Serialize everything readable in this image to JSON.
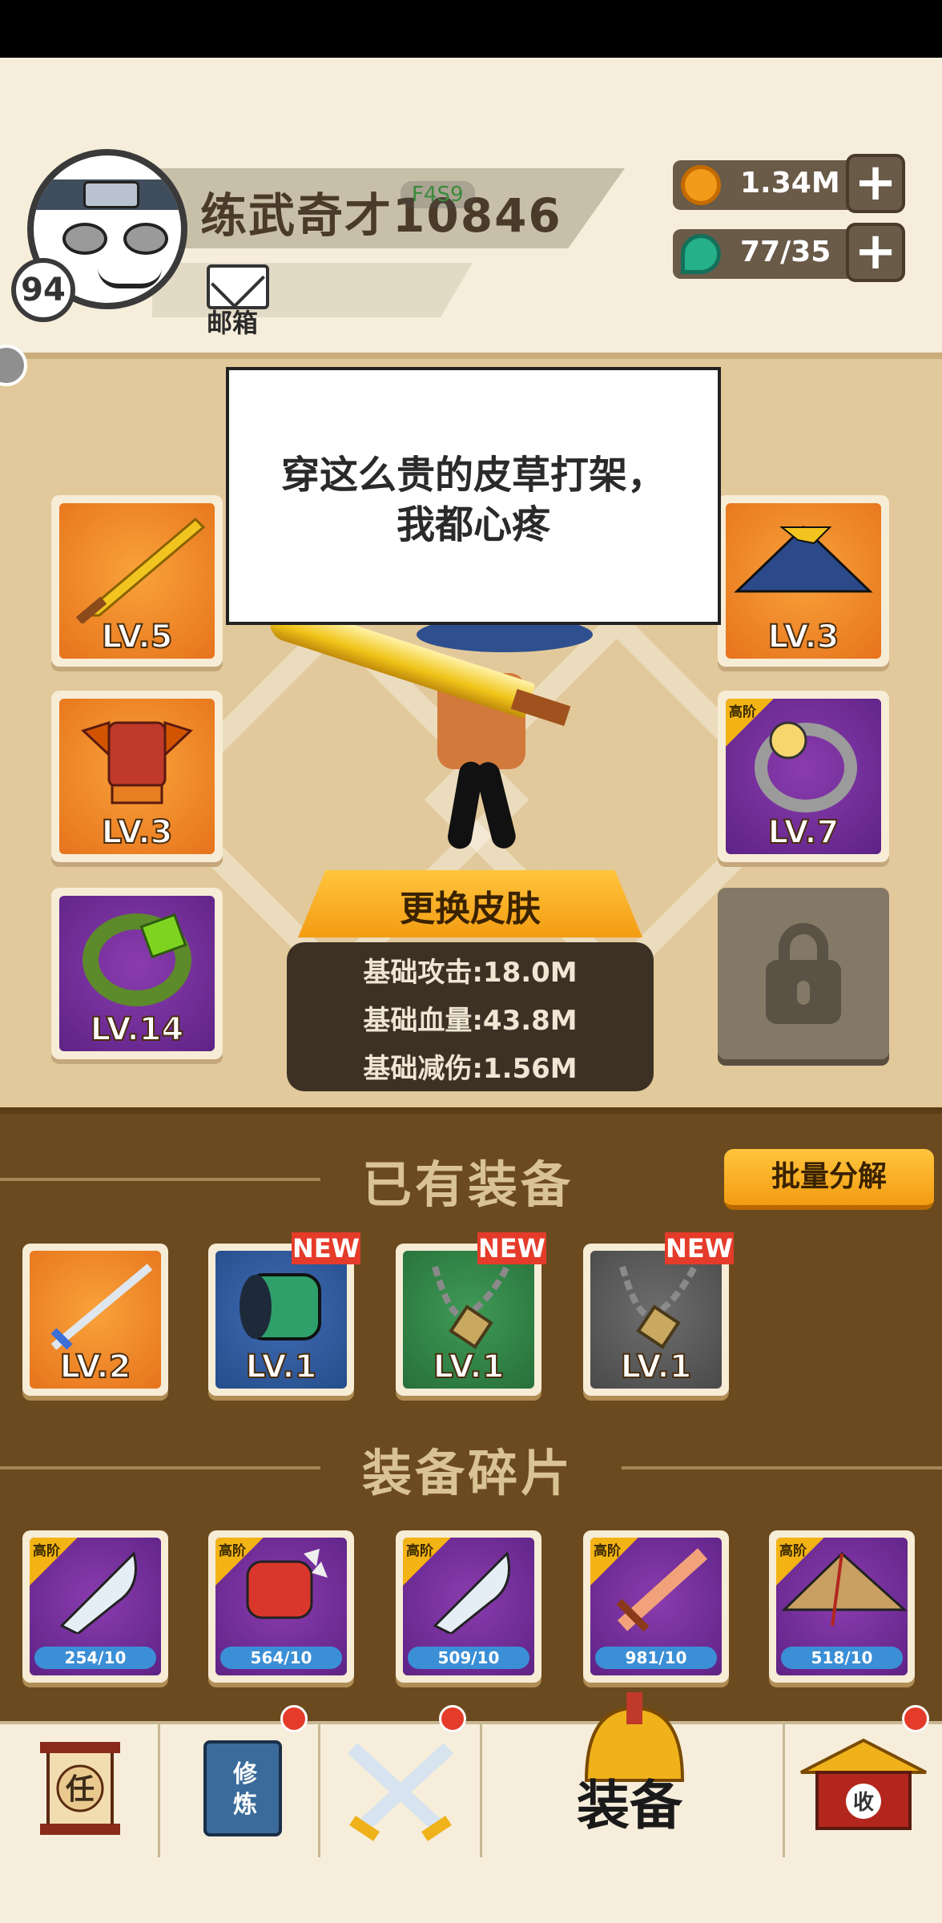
{
  "profile": {
    "name": "练武奇才10846",
    "tag": "F4S9",
    "level": "94",
    "mail_label": "邮箱"
  },
  "currency": {
    "coins": "1.34M",
    "gems": "77/35"
  },
  "dialog": {
    "line1": "穿这么贵的皮草打架，",
    "line2": "我都心疼"
  },
  "equipped": {
    "left": [
      {
        "level": "LV.5",
        "icon": "golden-sword-icon",
        "color": "orange"
      },
      {
        "level": "LV.3",
        "icon": "armor-icon",
        "color": "orange"
      },
      {
        "level": "LV.14",
        "icon": "bracelet-icon",
        "color": "purple"
      }
    ],
    "right": [
      {
        "level": "LV.3",
        "icon": "straw-hat-icon",
        "color": "orange"
      },
      {
        "level": "LV.7",
        "icon": "ring-icon",
        "color": "purple",
        "tier": "高阶"
      }
    ]
  },
  "skin_button": "更换皮肤",
  "stats": {
    "attack": "基础攻击:18.0M",
    "hp": "基础血量:43.8M",
    "reduction": "基础减伤:1.56M"
  },
  "inventory": {
    "title": "已有装备",
    "decompose_label": "批量分解",
    "items": [
      {
        "level": "LV.2",
        "icon": "sword-icon",
        "color": "orange",
        "new": ""
      },
      {
        "level": "LV.1",
        "icon": "gauntlet-icon",
        "color": "blue",
        "new": "NEW"
      },
      {
        "level": "LV.1",
        "icon": "necklace-icon",
        "color": "green",
        "new": "NEW"
      },
      {
        "level": "LV.1",
        "icon": "necklace-icon",
        "color": "grey",
        "new": "NEW"
      }
    ]
  },
  "fragments": {
    "title": "装备碎片",
    "items": [
      {
        "tier": "高阶",
        "count": "254/10",
        "icon": "broadsword-icon"
      },
      {
        "tier": "高阶",
        "count": "564/10",
        "icon": "spiked-gauntlet-icon"
      },
      {
        "tier": "高阶",
        "count": "509/10",
        "icon": "broadsword-icon"
      },
      {
        "tier": "高阶",
        "count": "981/10",
        "icon": "wooden-sword-icon"
      },
      {
        "tier": "高阶",
        "count": "518/10",
        "icon": "straw-hat-icon"
      }
    ]
  },
  "nav": {
    "task_glyph": "任",
    "train_glyph1": "修",
    "train_glyph2": "炼",
    "equip_label": "装备",
    "shop_glyph": "收"
  },
  "colors": {
    "accent": "#f39c12",
    "panel": "#6b4a1f",
    "badge_red": "#e53b2a"
  }
}
